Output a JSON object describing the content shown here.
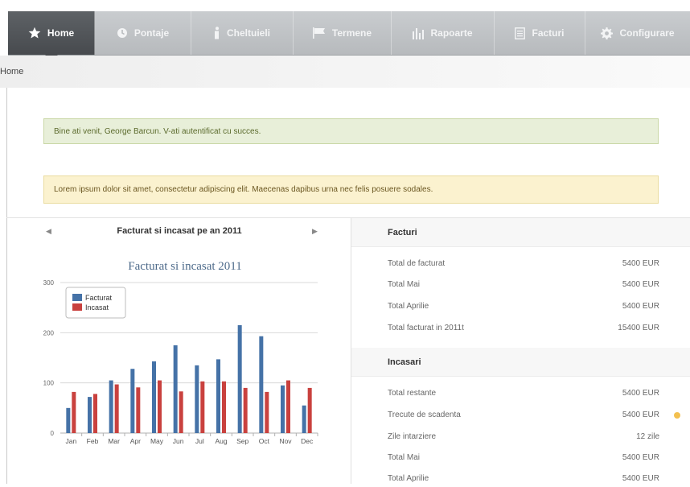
{
  "nav": {
    "items": [
      {
        "label": "Home",
        "icon": "star-icon",
        "active": true
      },
      {
        "label": "Pontaje",
        "icon": "clock-icon",
        "active": false
      },
      {
        "label": "Cheltuieli",
        "icon": "info-icon",
        "active": false
      },
      {
        "label": "Termene",
        "icon": "flag-icon",
        "active": false
      },
      {
        "label": "Rapoarte",
        "icon": "bar-chart-icon",
        "active": false
      },
      {
        "label": "Facturi",
        "icon": "document-icon",
        "active": false
      },
      {
        "label": "Configurare",
        "icon": "gear-icon",
        "active": false
      }
    ]
  },
  "breadcrumb": {
    "current": "Home"
  },
  "alerts": {
    "success": "Bine ati venit, George Barcun. V-ati autentificat cu succes.",
    "info": "Lorem ipsum dolor sit amet, consectetur adipiscing elit. Maecenas dapibus urna nec felis posuere sodales."
  },
  "chart_panel": {
    "header": "Facturat si incasat pe an 2011"
  },
  "chart_data": {
    "type": "bar",
    "title": "Facturat si incasat 2011",
    "categories": [
      "Jan",
      "Feb",
      "Mar",
      "Apr",
      "May",
      "Jun",
      "Jul",
      "Aug",
      "Sep",
      "Oct",
      "Nov",
      "Dec"
    ],
    "series": [
      {
        "name": "Facturat",
        "color": "#4572a7",
        "values": [
          50,
          72,
          105,
          128,
          143,
          175,
          135,
          147,
          215,
          193,
          95,
          55
        ]
      },
      {
        "name": "Incasat",
        "color": "#c9413e",
        "values": [
          82,
          78,
          97,
          91,
          105,
          83,
          103,
          103,
          90,
          82,
          105,
          90
        ]
      }
    ],
    "ylim": [
      0,
      300
    ],
    "yticks": [
      0,
      100,
      200,
      300
    ],
    "grid": true,
    "legend": "top-left"
  },
  "facturi": {
    "title": "Facturi",
    "rows": [
      {
        "label": "Total de facturat",
        "value": "5400 EUR"
      },
      {
        "label": "Total Mai",
        "value": "5400 EUR"
      },
      {
        "label": "Total Aprilie",
        "value": "5400 EUR"
      },
      {
        "label": "Total facturat in 2011t",
        "value": "15400 EUR"
      }
    ]
  },
  "incasari": {
    "title": "Incasari",
    "rows": [
      {
        "label": "Total restante",
        "value": "5400 EUR"
      },
      {
        "label": "Trecute de scadenta",
        "value": "5400 EUR",
        "alert": true
      },
      {
        "label": "Zile intarziere",
        "value": "12 zile"
      },
      {
        "label": "Total Mai",
        "value": "5400 EUR"
      },
      {
        "label": "Total Aprilie",
        "value": "5400 EUR"
      }
    ]
  }
}
